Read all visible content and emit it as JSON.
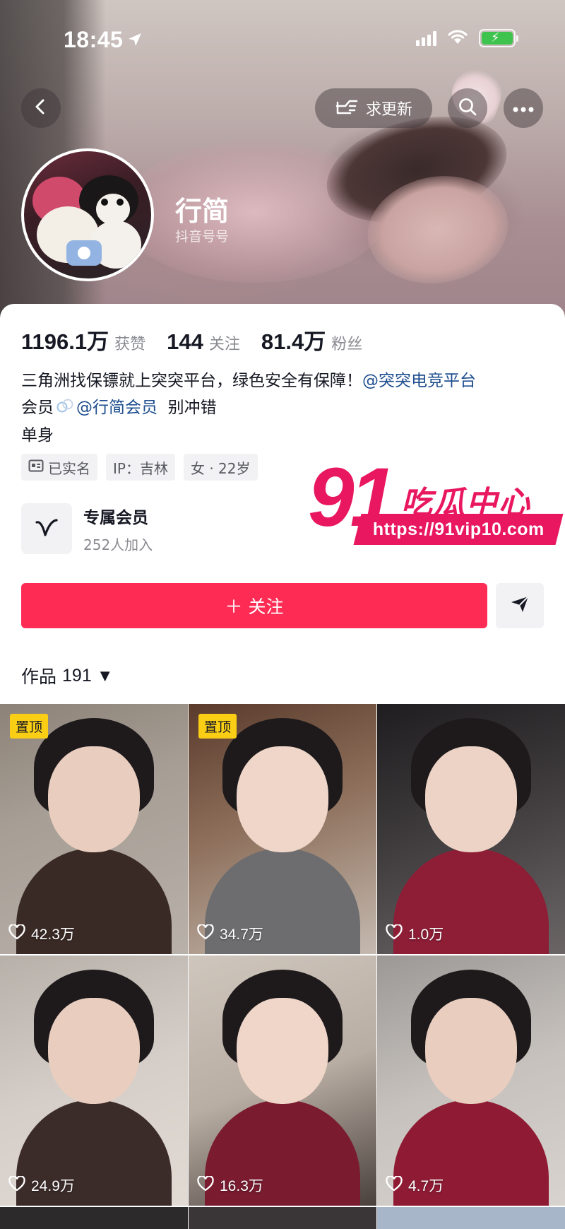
{
  "status_bar": {
    "time": "18:45"
  },
  "header": {
    "update_label": "求更新",
    "display_name": "行简",
    "douyin_id_label": "抖音号号"
  },
  "stats": [
    {
      "num": "1196.1万",
      "label": "获赞"
    },
    {
      "num": "144",
      "label": "关注"
    },
    {
      "num": "81.4万",
      "label": "粉丝"
    }
  ],
  "bio": {
    "line1_text": "三角洲找保镖就上突突平台，绿色安全有保障！",
    "line1_mention": "@突突电竞平台",
    "line2_prefix": "会员",
    "line2_mention": "@行简会员",
    "line2_suffix": "别冲错",
    "line3": "单身"
  },
  "tags": [
    {
      "icon": "id-card-icon",
      "label": "已实名"
    },
    {
      "label": "IP：吉林"
    },
    {
      "label": "女 · 22岁"
    }
  ],
  "membership": {
    "title": "专属会员",
    "subtitle": "252人加入"
  },
  "watermark": {
    "big": "91",
    "text": "吃瓜中心",
    "url": "https://91vip10.com"
  },
  "actions": {
    "follow_label": "＋ 关注"
  },
  "works_tab": {
    "label": "作品",
    "count": "191"
  },
  "videos": [
    {
      "likes": "42.3万",
      "pinned": "置顶"
    },
    {
      "likes": "34.7万",
      "pinned": "置顶"
    },
    {
      "likes": "1.0万"
    },
    {
      "likes": "24.9万"
    },
    {
      "likes": "16.3万"
    },
    {
      "likes": "4.7万"
    }
  ],
  "colors": {
    "accent": "#fe2c55",
    "mention": "#1d4d8f",
    "pin_badge": "#face15",
    "watermark": "#e8175f"
  }
}
